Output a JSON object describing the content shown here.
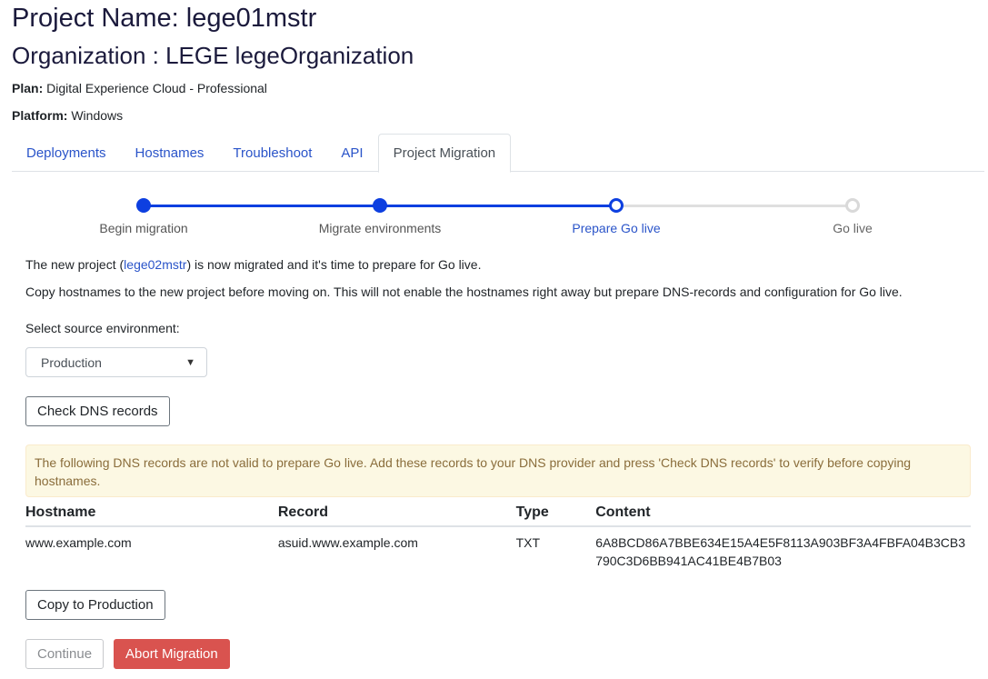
{
  "project": {
    "title": "Project Name: lege01mstr",
    "organization": "Organization : LEGE legeOrganization",
    "plan_label": "Plan:",
    "plan_value": "Digital Experience Cloud - Professional",
    "platform_label": "Platform:",
    "platform_value": "Windows"
  },
  "tabs": [
    {
      "label": "Deployments",
      "active": false
    },
    {
      "label": "Hostnames",
      "active": false
    },
    {
      "label": "Troubleshoot",
      "active": false
    },
    {
      "label": "API",
      "active": false
    },
    {
      "label": "Project Migration",
      "active": true
    }
  ],
  "stepper": {
    "steps": [
      {
        "label": "Begin migration",
        "state": "done"
      },
      {
        "label": "Migrate environments",
        "state": "done"
      },
      {
        "label": "Prepare Go live",
        "state": "current"
      },
      {
        "label": "Go live",
        "state": "future"
      }
    ]
  },
  "intro": {
    "line1_prefix": "The new project (",
    "line1_link": "lege02mstr",
    "line1_suffix": ") is now migrated and it's time to prepare for Go live.",
    "line2": "Copy hostnames to the new project before moving on. This will not enable the hostnames right away but prepare DNS-records and configuration for Go live.",
    "select_label": "Select source environment:"
  },
  "source_select": {
    "value": "Production"
  },
  "buttons": {
    "check_dns": "Check DNS records",
    "copy": "Copy to Production",
    "continue": "Continue",
    "abort": "Abort Migration"
  },
  "alert": {
    "text": "The following DNS records are not valid to prepare Go live. Add these records to your DNS provider and press 'Check DNS records' to verify before copying hostnames."
  },
  "dns_table": {
    "headers": [
      "Hostname",
      "Record",
      "Type",
      "Content"
    ],
    "rows": [
      [
        "www.example.com",
        "asuid.www.example.com",
        "TXT",
        "6A8BCD86A7BBE634E15A4E5F8113A903BF3A4FBFA04B3CB3790C3D6BB941AC41BE4B7B03"
      ]
    ]
  },
  "colors": {
    "accent": "#0d3fe0",
    "link": "#2a54c9",
    "danger": "#d9534f",
    "warning_bg": "#fcf8e3"
  }
}
